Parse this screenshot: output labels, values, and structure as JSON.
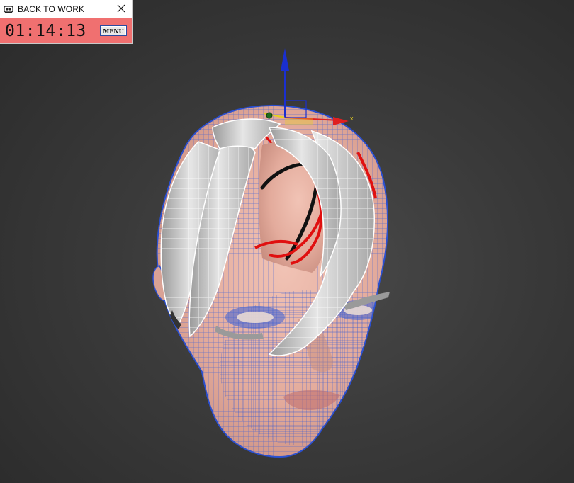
{
  "timer": {
    "title": "BACK TO WORK",
    "time": "01:14:13",
    "menu_label": "MENU",
    "app_icon": "dial-icon",
    "close_icon": "close-icon"
  },
  "viewport": {
    "gizmo_axis_x_label": "x",
    "colors": {
      "background": "#3a3a3a",
      "skin": "#e8b4a6",
      "wire": "#3a5fd6",
      "hair": "#d9d9d9",
      "gizmo_x": "#e02020",
      "gizmo_z": "#1a2fd0",
      "gizmo_y": "#e8d020"
    }
  }
}
